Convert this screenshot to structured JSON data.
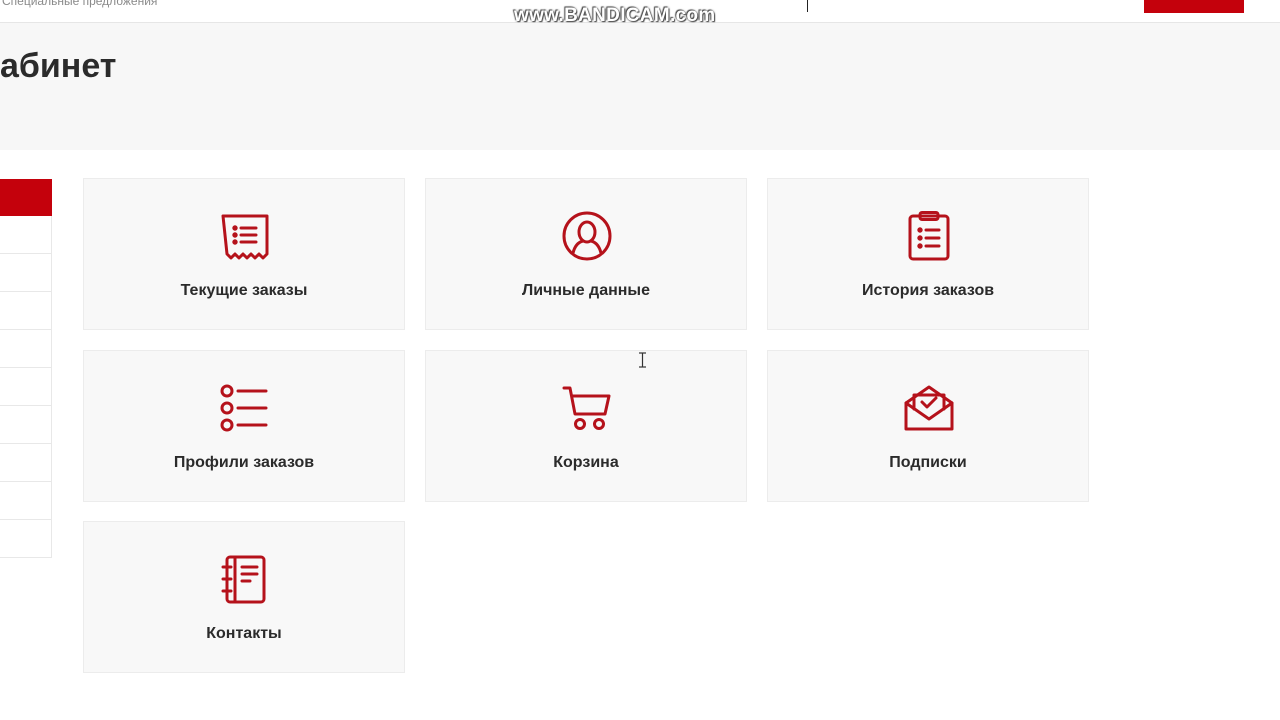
{
  "topbar": {
    "link_label": "Специальные предложения",
    "watermark": "www.BANDICAM.com"
  },
  "page": {
    "title": "абинет"
  },
  "colors": {
    "accent": "#c4010c",
    "tile_bg": "#f8f8f8",
    "hero_bg": "#f7f7f7",
    "text": "#2b2b2b"
  },
  "tiles": [
    {
      "label": "Текущие заказы",
      "icon": "receipt-list-icon"
    },
    {
      "label": "Личные данные",
      "icon": "user-circle-icon"
    },
    {
      "label": "История заказов",
      "icon": "clipboard-list-icon"
    },
    {
      "label": "Профили заказов",
      "icon": "bullet-list-icon"
    },
    {
      "label": "Корзина",
      "icon": "cart-icon"
    },
    {
      "label": "Подписки",
      "icon": "envelope-check-icon"
    },
    {
      "label": "Контакты",
      "icon": "address-book-icon"
    }
  ]
}
